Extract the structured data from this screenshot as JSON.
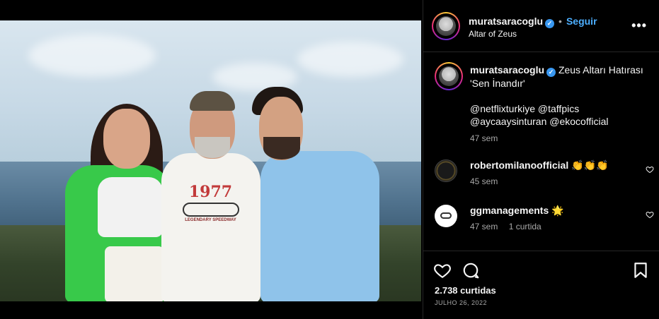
{
  "post": {
    "author": "muratsaracoglu",
    "verified_mark": "✓",
    "separator": "•",
    "follow_label": "Seguir",
    "location": "Altar of Zeus",
    "more_label": "•••"
  },
  "caption": {
    "author": "muratsaracoglu",
    "line1": "Zeus Altarı Hatırası",
    "line2": "'Sen İnandır'",
    "tags1": "@netflixturkiye @taffpics",
    "tags2": "@aycaaysinturan @ekocofficial",
    "time": "47 sem"
  },
  "comments": [
    {
      "author": "robertomilanoofficial",
      "text": "👏👏👏",
      "time": "45 sem",
      "replies": ""
    },
    {
      "author": "ggmanagements",
      "text": "🌟",
      "time": "47 sem",
      "replies": "1 curtida"
    }
  ],
  "actions": {
    "likes": "2.738 curtidas",
    "date": "JULHO 26, 2022"
  },
  "image": {
    "print_year": "1977",
    "print_text": "LEGENDARY SPEEDWAY"
  },
  "icons": [
    "more-icon",
    "verified-icon",
    "heart-icon",
    "comment-icon",
    "bookmark-icon"
  ],
  "colors": {
    "accent": "#4dafff",
    "verified": "#3897f0",
    "background": "#000000",
    "divider": "#262626"
  }
}
